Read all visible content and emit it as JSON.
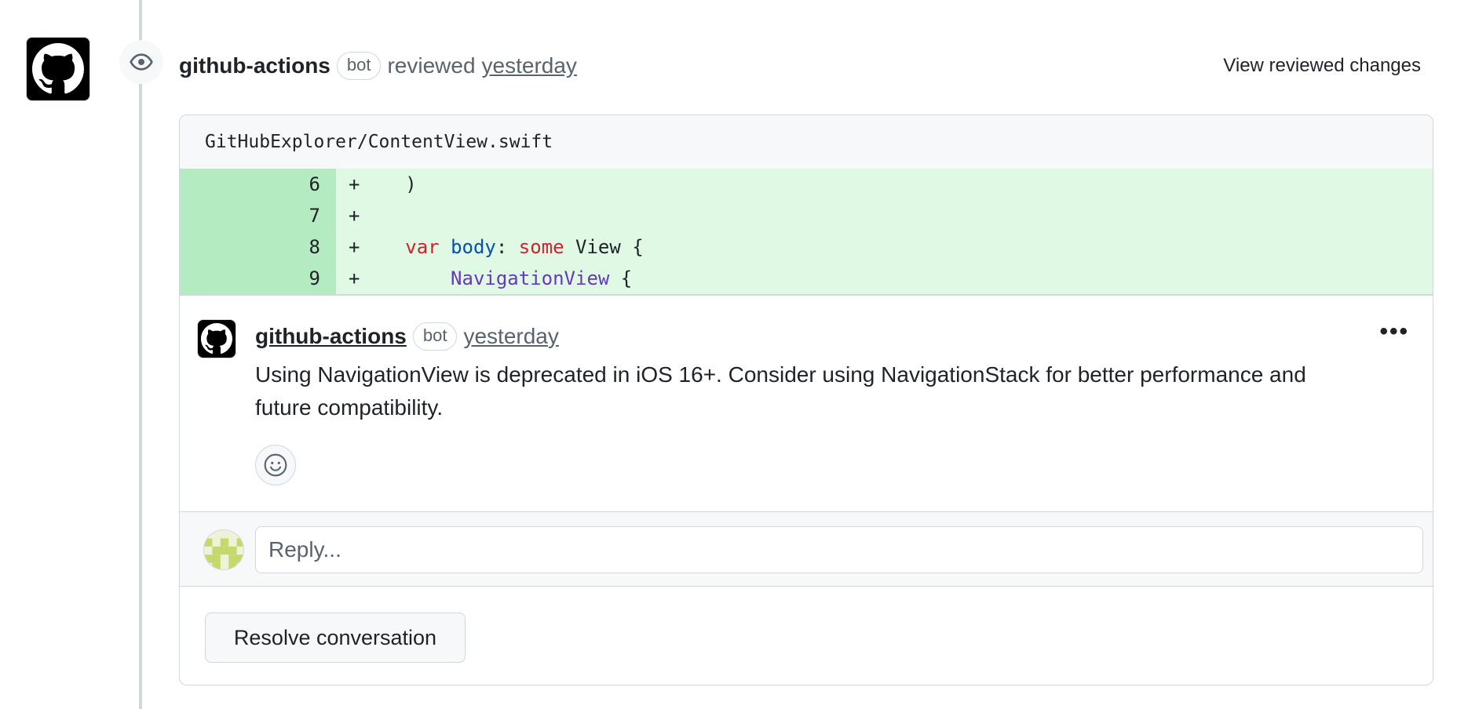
{
  "review": {
    "author": "github-actions",
    "badge": "bot",
    "action": "reviewed",
    "time": "yesterday",
    "view_changes_label": "View reviewed changes"
  },
  "file": {
    "path": "GitHubExplorer/ContentView.swift",
    "lines": [
      {
        "number": "6",
        "sign": "+"
      },
      {
        "number": "7",
        "sign": "+"
      },
      {
        "number": "8",
        "sign": "+"
      },
      {
        "number": "9",
        "sign": "+"
      }
    ],
    "code": {
      "line6": "    )",
      "line7": "",
      "line8_kw1": "var",
      "line8_fn": "body",
      "line8_colon": ":",
      "line8_kw2": "some",
      "line8_rest": "View {",
      "line9_type": "NavigationView",
      "line9_rest": "{"
    }
  },
  "comment": {
    "author": "github-actions",
    "badge": "bot",
    "time": "yesterday",
    "more_label": "•••",
    "body": "Using NavigationView is deprecated in iOS 16+. Consider using NavigationStack for better performance and future compatibility."
  },
  "reply": {
    "placeholder": "Reply..."
  },
  "resolve_label": "Resolve conversation",
  "icons": {
    "avatar": "github-octocat-icon",
    "review": "eye-icon",
    "reaction": "smiley-icon",
    "user": "identicon-avatar"
  }
}
